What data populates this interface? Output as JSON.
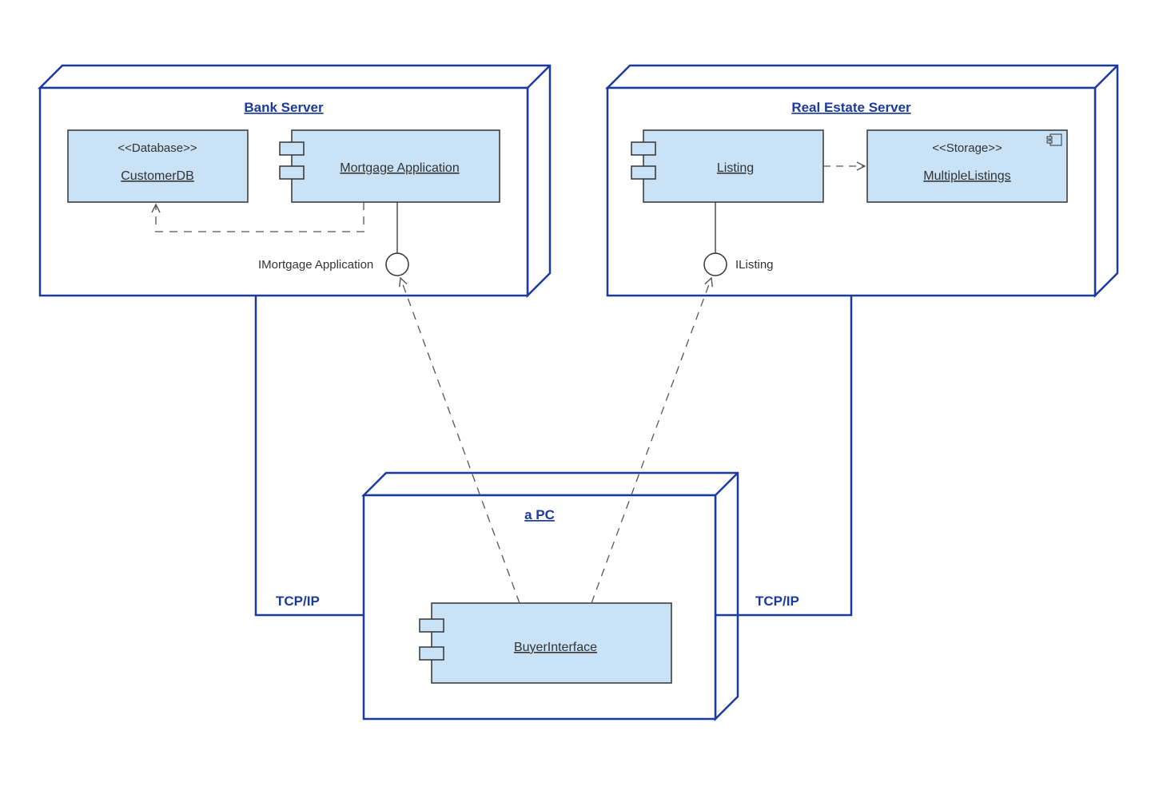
{
  "nodes": {
    "bank": {
      "title": "Bank Server"
    },
    "real_estate": {
      "title": "Real Estate Server"
    },
    "pc": {
      "title": "a PC"
    }
  },
  "components": {
    "customer_db": {
      "stereotype": "<<Database>>",
      "name": "CustomerDB"
    },
    "mortgage_app": {
      "name": "Mortgage Application"
    },
    "listing": {
      "name": "Listing"
    },
    "multi_listings": {
      "stereotype": "<<Storage>>",
      "name": "MultipleListings"
    },
    "buyer_interface": {
      "name": "BuyerInterface"
    }
  },
  "interfaces": {
    "imortgage": "IMortgage Application",
    "ilisting": "IListing"
  },
  "connections": {
    "left": "TCP/IP",
    "right": "TCP/IP"
  }
}
